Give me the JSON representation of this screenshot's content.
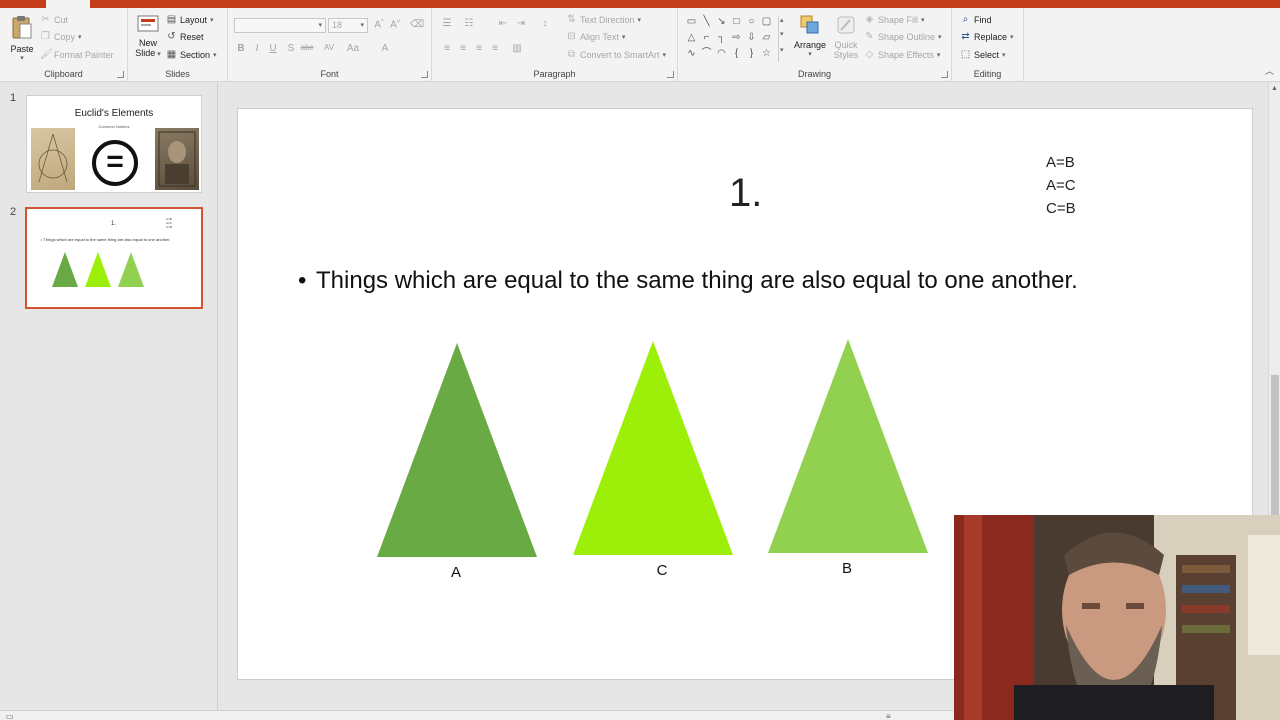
{
  "ribbon": {
    "clipboard": {
      "label": "Clipboard",
      "paste": "Paste",
      "cut": "Cut",
      "copy": "Copy",
      "format_painter": "Format Painter"
    },
    "slides": {
      "label": "Slides",
      "new_slide_line1": "New",
      "new_slide_line2": "Slide",
      "layout": "Layout",
      "reset": "Reset",
      "section": "Section"
    },
    "font": {
      "label": "Font",
      "size": "18"
    },
    "paragraph": {
      "label": "Paragraph",
      "text_direction": "Text Direction",
      "align_text": "Align Text",
      "convert_smartart": "Convert to SmartArt"
    },
    "drawing": {
      "label": "Drawing",
      "arrange": "Arrange",
      "quick_styles_line1": "Quick",
      "quick_styles_line2": "Styles",
      "shape_fill": "Shape Fill",
      "shape_outline": "Shape Outline",
      "shape_effects": "Shape Effects"
    },
    "editing": {
      "label": "Editing",
      "find": "Find",
      "replace": "Replace",
      "select": "Select"
    }
  },
  "thumbnails": [
    {
      "number": "1",
      "title": "Euclid's Elements",
      "subtitle": "Common Notions",
      "symbol": "="
    },
    {
      "number": "2",
      "title": "1.",
      "equations": [
        "A=B",
        "A=C",
        "C=B"
      ],
      "bullet": "Things which are equal to the same thing are also equal to one another."
    }
  ],
  "slide": {
    "title": "1.",
    "equations": [
      "A=B",
      "A=C",
      "C=B"
    ],
    "bullet": "Things which are equal to the same thing are also equal to one another.",
    "triangles": [
      {
        "label": "A",
        "color": "#6aaa44"
      },
      {
        "label": "C",
        "color": "#9def0a"
      },
      {
        "label": "B",
        "color": "#92d050"
      }
    ]
  },
  "colors": {
    "accent": "#c43e1c",
    "selected_border": "#d35230"
  },
  "icons": {
    "paste": "clipboard-paste-icon",
    "cut": "scissors-icon",
    "copy": "copy-icon",
    "format_painter": "paintbrush-icon",
    "new_slide": "new-slide-icon",
    "find": "search-icon",
    "replace": "replace-icon",
    "select": "cursor-icon",
    "arrange": "arrange-icon"
  }
}
